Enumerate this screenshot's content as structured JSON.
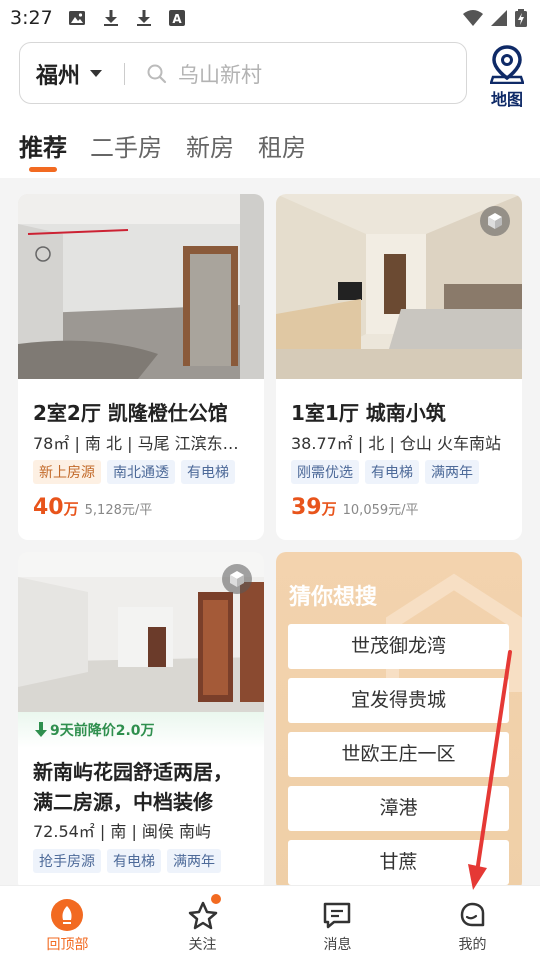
{
  "status_bar": {
    "time": "3:27"
  },
  "search": {
    "city": "福州",
    "placeholder": "乌山新村",
    "map_label": "地图"
  },
  "tabs": [
    {
      "label": "推荐",
      "active": true
    },
    {
      "label": "二手房",
      "active": false
    },
    {
      "label": "新房",
      "active": false
    },
    {
      "label": "租房",
      "active": false
    }
  ],
  "listings": [
    {
      "title": "2室2厅 凯隆橙仕公馆",
      "meta": "78㎡ | 南 北 | 马尾 江滨东…",
      "tags": [
        "新上房源",
        "南北通透",
        "有电梯"
      ],
      "price": "40",
      "price_unit": "万",
      "unit_price": "5,128元/平"
    },
    {
      "title": "1室1厅 城南小筑",
      "meta": "38.77㎡ | 北 | 仓山 火车南站",
      "tags": [
        "刚需优选",
        "有电梯",
        "满两年"
      ],
      "price": "39",
      "price_unit": "万",
      "unit_price": "10,059元/平"
    },
    {
      "price_drop": "9天前降价2.0万",
      "title_line1": "新南屿花园舒适两居，",
      "title_line2": "满二房源，中档装修",
      "meta": "72.54㎡ | 南 | 闽侯 南屿",
      "tags": [
        "抢手房源",
        "有电梯",
        "满两年"
      ]
    }
  ],
  "guess": {
    "title": "猜你想搜",
    "items": [
      "世茂御龙湾",
      "宜发得贵城",
      "世欧王庄一区",
      "漳港",
      "甘蔗"
    ]
  },
  "bottom_nav": [
    {
      "label": "回顶部",
      "active": true
    },
    {
      "label": "关注",
      "active": false
    },
    {
      "label": "消息",
      "active": false
    },
    {
      "label": "我的",
      "active": false
    }
  ],
  "colors": {
    "accent": "#f26a21",
    "price": "#e8541b",
    "annotation_arrow": "#e53935"
  }
}
